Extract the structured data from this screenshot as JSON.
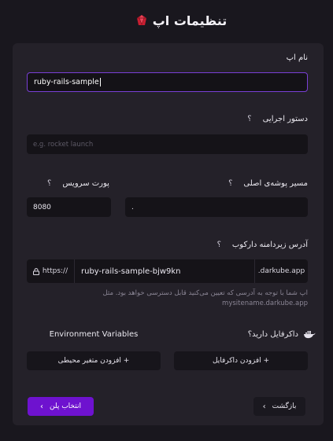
{
  "header": {
    "title": "تنظیمات اپ",
    "logo_icon": "ruby-icon"
  },
  "app_name": {
    "label": "نام اپ",
    "value": "ruby-rails-sample"
  },
  "run_command": {
    "label": "دستور اجرایی",
    "help": "؟",
    "placeholder": "e.g. rocket launch"
  },
  "service_port": {
    "label": "پورت سرویس",
    "help": "؟",
    "value": "8080"
  },
  "root_dir": {
    "label": "مسیر پوشه‌ی اصلی",
    "help": "؟",
    "value": "."
  },
  "subdomain": {
    "label": "آدرس زیردامنه دارکوب",
    "help": "؟",
    "protocol": "https://",
    "value": "ruby-rails-sample-bjw9kn",
    "suffix": ".darkube.app",
    "hint_line1": "اپ شما با توجه به آدرسی که تعیین می‌کنید قابل دسترسی خواهد بود. مثل",
    "hint_line2": "mysitename.darkube.app"
  },
  "dockerfile": {
    "label": "داکرفایل دارید؟",
    "button": "+ افزودن داکرفایل",
    "icon": "docker-icon"
  },
  "env_vars": {
    "label": "Environment Variables",
    "button": "+ افزودن متغیر محیطی"
  },
  "footer": {
    "back_label": "بازگشت",
    "next_label": "انتخاب پلن"
  },
  "colors": {
    "accent": "#6e12cf",
    "focus_border": "#7a3fd6",
    "ruby": "#e0283c",
    "docker": "#e6e3ec"
  }
}
